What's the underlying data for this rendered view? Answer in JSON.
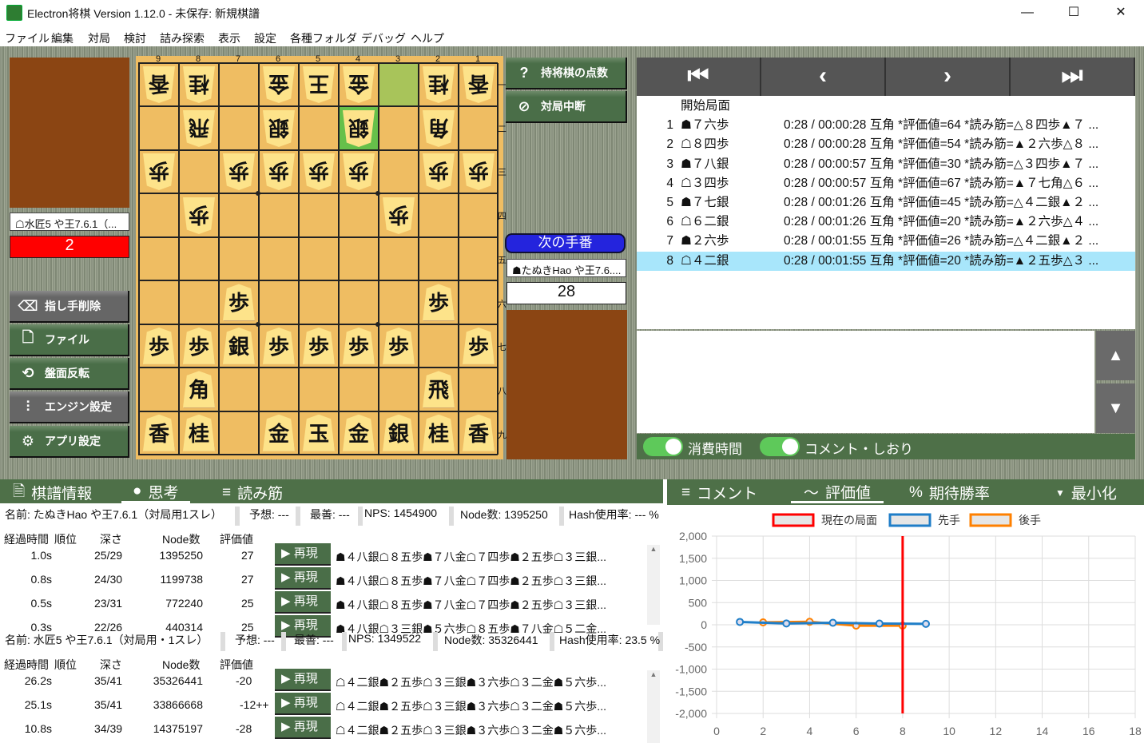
{
  "window": {
    "title": "Electron将棋 Version 1.12.0 - 未保存: 新規棋譜",
    "minimize": "—",
    "maximize": "☐",
    "close": "✕"
  },
  "menu": [
    "ファイル",
    "編集",
    "対局",
    "検討",
    "詰み探索",
    "表示",
    "設定",
    "各種フォルダ",
    "デバッグ",
    "ヘルプ"
  ],
  "gote": {
    "name": "☖水匠5 や王7.6.1（...",
    "clock": "2",
    "clock_color": "#ff0000"
  },
  "sente": {
    "name": "☗たぬきHao や王7.6....",
    "clock": "28"
  },
  "turn_label": "次の手番",
  "left_buttons": [
    {
      "label": "指し手削除",
      "icon": "backspace-icon"
    },
    {
      "label": "ファイル",
      "icon": "file-icon"
    },
    {
      "label": "盤面反転",
      "icon": "flip-icon"
    },
    {
      "label": "エンジン設定",
      "icon": "sliders-icon"
    },
    {
      "label": "アプリ設定",
      "icon": "gear-icon"
    }
  ],
  "right_buttons": [
    {
      "label": "持将棋の点数",
      "icon": "question-icon"
    },
    {
      "label": "対局中断",
      "icon": "stop-icon"
    }
  ],
  "board": {
    "files": [
      "9",
      "8",
      "7",
      "6",
      "5",
      "4",
      "3",
      "2",
      "1"
    ],
    "ranks": [
      "一",
      "二",
      "三",
      "四",
      "五",
      "六",
      "七",
      "八",
      "九"
    ],
    "rows": [
      [
        "v香",
        "v桂",
        "",
        "v金",
        "v王",
        "v金",
        "",
        "v桂",
        "v香"
      ],
      [
        "",
        "v飛",
        "",
        "v銀",
        "",
        "v銀",
        "",
        "v角",
        ""
      ],
      [
        "v歩",
        "",
        "v歩",
        "v歩",
        "v歩",
        "v歩",
        "",
        "v歩",
        "v歩"
      ],
      [
        "",
        "v歩",
        "",
        "",
        "",
        "",
        "v歩",
        "",
        ""
      ],
      [
        "",
        "",
        "",
        "",
        "",
        "",
        "",
        "",
        ""
      ],
      [
        "",
        "",
        "歩",
        "",
        "",
        "",
        "",
        "歩",
        ""
      ],
      [
        "歩",
        "歩",
        "銀",
        "歩",
        "歩",
        "歩",
        "歩",
        "",
        "歩"
      ],
      [
        "",
        "角",
        "",
        "",
        "",
        "",
        "",
        "飛",
        ""
      ],
      [
        "香",
        "桂",
        "",
        "金",
        "玉",
        "金",
        "銀",
        "桂",
        "香"
      ]
    ],
    "last_from": "3一",
    "last_to": "4二",
    "from_color": "#a8c45a",
    "to_color": "#66c04a"
  },
  "nav": [
    "⏮",
    "‹",
    "›",
    "⏭"
  ],
  "moves": [
    {
      "n": "",
      "m": "開始局面",
      "c": ""
    },
    {
      "n": "1",
      "m": "☗７六歩",
      "c": "0:28 / 00:00:28 互角 *評価値=64 *読み筋=△８四歩▲７ ..."
    },
    {
      "n": "2",
      "m": "☖８四歩",
      "c": "0:28 / 00:00:28 互角 *評価値=54 *読み筋=▲２六歩△８ ..."
    },
    {
      "n": "3",
      "m": "☗７八銀",
      "c": "0:28 / 00:00:57 互角 *評価値=30 *読み筋=△３四歩▲７ ..."
    },
    {
      "n": "4",
      "m": "☖３四歩",
      "c": "0:28 / 00:00:57 互角 *評価値=67 *読み筋=▲７七角△６ ..."
    },
    {
      "n": "5",
      "m": "☗７七銀",
      "c": "0:28 / 00:01:26 互角 *評価値=45 *読み筋=△４二銀▲２ ..."
    },
    {
      "n": "6",
      "m": "☖６二銀",
      "c": "0:28 / 00:01:26 互角 *評価値=20 *読み筋=▲２六歩△４ ..."
    },
    {
      "n": "7",
      "m": "☗２六歩",
      "c": "0:28 / 00:01:55 互角 *評価値=26 *読み筋=△４二銀▲２ ..."
    },
    {
      "n": "8",
      "m": "☖４二銀",
      "c": "0:28 / 00:01:55 互角 *評価値=20 *読み筋=▲２五歩△３ ..."
    }
  ],
  "selected_move": 8,
  "toggles": [
    {
      "label": "消費時間",
      "on": true
    },
    {
      "label": "コメント・しおり",
      "on": true
    }
  ],
  "left_tabs": [
    {
      "label": "棋譜情報",
      "icon": "document-icon"
    },
    {
      "label": "思考",
      "icon": "head-icon",
      "active": true
    },
    {
      "label": "読み筋",
      "icon": "search-list-icon"
    }
  ],
  "right_tabs": [
    {
      "label": "コメント",
      "icon": "edit-list-icon"
    },
    {
      "label": "評価値",
      "icon": "chart-line-icon",
      "active": true
    },
    {
      "label": "期待勝率",
      "icon": "percent-icon"
    },
    {
      "label": "最小化",
      "icon": "caret-down-icon"
    }
  ],
  "columns": [
    "経過時間",
    "順位",
    "深さ",
    "Node数",
    "評価値"
  ],
  "play_label": "再現",
  "engines": [
    {
      "info": [
        "名前: たぬきHao や王7.6.1（対局用1スレ）",
        "予想: ---",
        "最善: ---",
        "NPS: 1454900",
        "Node数: 1395250",
        "Hash使用率: --- %"
      ],
      "rows": [
        {
          "time": "1.0s",
          "depth": "25/29",
          "nodes": "1395250",
          "score": "27",
          "pv": "☗４八銀☖８五歩☗７八金☖７四歩☗２五歩☖３三銀..."
        },
        {
          "time": "0.8s",
          "depth": "24/30",
          "nodes": "1199738",
          "score": "27",
          "pv": "☗４八銀☖８五歩☗７八金☖７四歩☗２五歩☖３三銀..."
        },
        {
          "time": "0.5s",
          "depth": "23/31",
          "nodes": "772240",
          "score": "25",
          "pv": "☗４八銀☖８五歩☗７八金☖７四歩☗２五歩☖３三銀..."
        },
        {
          "time": "0.3s",
          "depth": "22/26",
          "nodes": "440314",
          "score": "25",
          "pv": "☗４八銀☖３三銀☗５六歩☖８五歩☗７八金☖５二金..."
        }
      ]
    },
    {
      "info": [
        "名前: 水匠5 や王7.6.1（対局用・1スレ）",
        "予想: ---",
        "最善: ---",
        "NPS: 1349522",
        "Node数: 35326441",
        "Hash使用率: 23.5 %"
      ],
      "rows": [
        {
          "time": "26.2s",
          "depth": "35/41",
          "nodes": "35326441",
          "score": "-20",
          "pv": "☖４二銀☗２五歩☖３三銀☗３六歩☖３二金☗５六歩..."
        },
        {
          "time": "25.1s",
          "depth": "35/41",
          "nodes": "33866668",
          "score": "-12++",
          "pv": "☖４二銀☗２五歩☖３三銀☗３六歩☖３二金☗５六歩..."
        },
        {
          "time": "10.8s",
          "depth": "34/39",
          "nodes": "14375197",
          "score": "-28",
          "pv": "☖４二銀☗２五歩☖３三銀☗３六歩☖３二金☗５六歩..."
        }
      ]
    }
  ],
  "chart_data": {
    "type": "line",
    "legend": [
      {
        "name": "現在の局面",
        "color": "#ff0000"
      },
      {
        "name": "先手",
        "color": "#1f7ec8"
      },
      {
        "name": "後手",
        "color": "#ff8000"
      }
    ],
    "legend_placement": "top",
    "xlim": [
      0,
      18
    ],
    "ylim": [
      -2000,
      2000
    ],
    "xticks": [
      "0",
      "2",
      "4",
      "6",
      "8",
      "10",
      "12",
      "14",
      "16",
      "18"
    ],
    "yticks": [
      "2,000",
      "1,500",
      "1,000",
      "500",
      "0",
      "-500",
      "-1,000",
      "-1,500",
      "-2,000"
    ],
    "grid": true,
    "current_position": 8,
    "series": [
      {
        "name": "先手",
        "x": [
          1,
          3,
          5,
          7,
          9
        ],
        "y": [
          64,
          30,
          45,
          26,
          20
        ]
      },
      {
        "name": "後手",
        "x": [
          2,
          4,
          6,
          8
        ],
        "y": [
          54,
          67,
          -20,
          -20
        ]
      }
    ]
  }
}
